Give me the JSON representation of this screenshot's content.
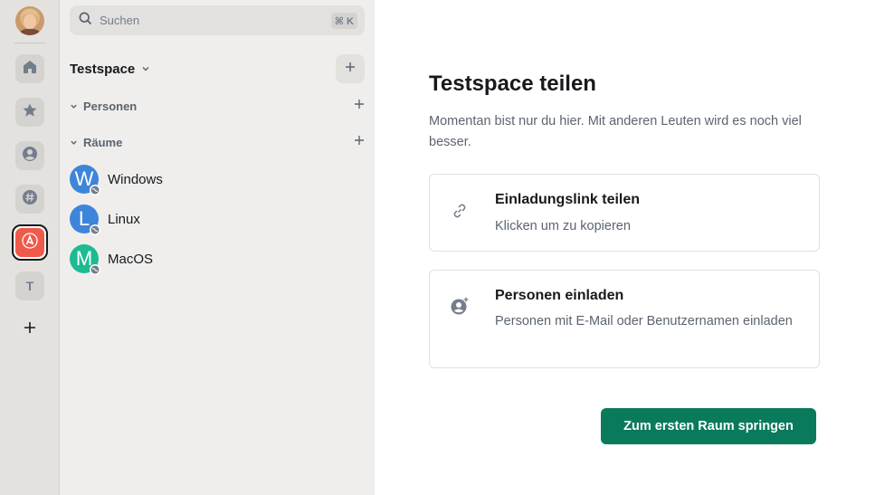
{
  "colors": {
    "accent": "#0a7a5c",
    "active_space": "#f05a4a",
    "room_windows": "#3d85d9",
    "room_linux": "#3d85d9",
    "room_macos": "#1dbb92"
  },
  "rail": {
    "items": [
      {
        "icon": "home-icon"
      },
      {
        "icon": "star-icon"
      },
      {
        "icon": "person-icon"
      },
      {
        "icon": "hashtag-icon"
      },
      {
        "icon": "space-logo-icon",
        "active": true
      },
      {
        "letter": "T"
      },
      {
        "icon": "plus-icon"
      }
    ],
    "letter_space": "T"
  },
  "search": {
    "placeholder": "Suchen",
    "shortcut": "⌘ K"
  },
  "space": {
    "name": "Testspace"
  },
  "sections": {
    "people": {
      "label": "Personen"
    },
    "rooms": {
      "label": "Räume"
    }
  },
  "rooms": [
    {
      "initial": "W",
      "name": "Windows"
    },
    {
      "initial": "L",
      "name": "Linux"
    },
    {
      "initial": "M",
      "name": "MacOS"
    }
  ],
  "main": {
    "title": "Testspace teilen",
    "subtitle": "Momentan bist nur du hier. Mit anderen Leuten wird es noch viel besser.",
    "cards": [
      {
        "icon": "link-icon",
        "title": "Einladungslink teilen",
        "description": "Klicken um zu kopieren"
      },
      {
        "icon": "invite-person-icon",
        "title": "Personen einladen",
        "description": "Personen mit E-Mail oder Benutzernamen einladen"
      }
    ],
    "primary_button": "Zum ersten Raum springen"
  }
}
